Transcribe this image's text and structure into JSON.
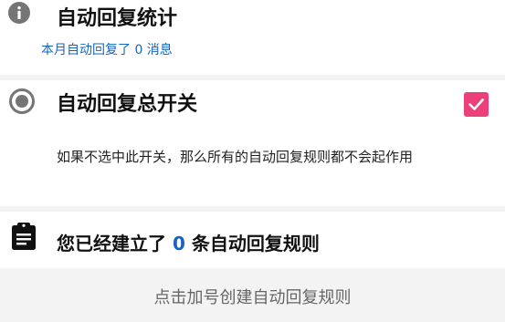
{
  "stats": {
    "icon": "info-icon",
    "title": "自动回复统计",
    "subtitle": "本月自动回复了 0 消息"
  },
  "master_switch": {
    "icon": "radio-selected-icon",
    "title": "自动回复总开关",
    "checked": true,
    "checkbox_color": "#ec407a",
    "description": "如果不选中此开关，那么所有的自动回复规则都不会起作用"
  },
  "rules": {
    "icon": "clipboard-icon",
    "title_prefix": "您已经建立了 ",
    "count": "0",
    "title_suffix": " 条自动回复规则",
    "count_color": "#1565c0"
  },
  "add_hint": {
    "label": "点击加号创建自动回复规则"
  }
}
